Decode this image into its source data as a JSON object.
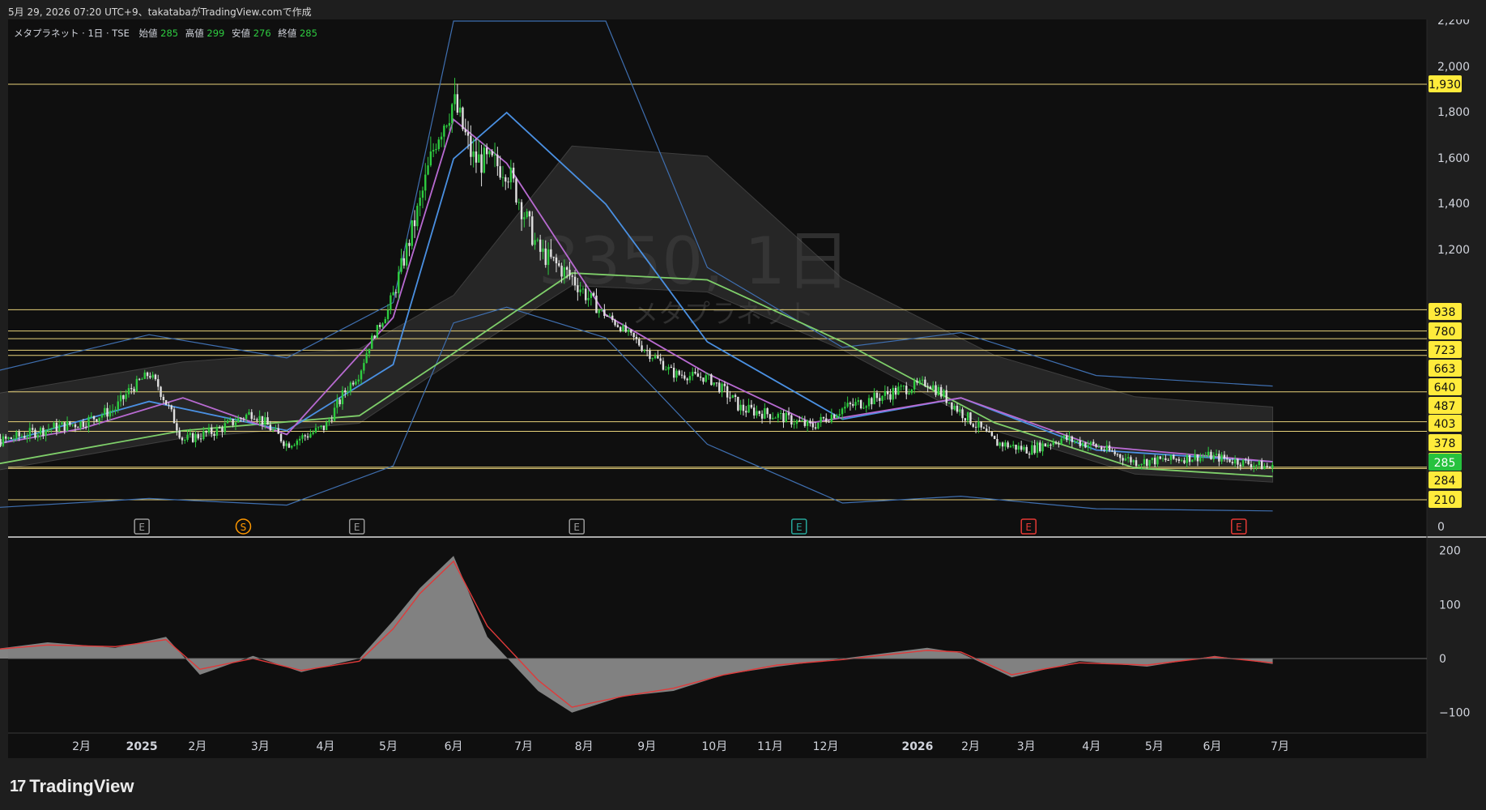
{
  "header": {
    "created_line": "5月 29, 2026 07:20 UTC+9、takatabaがTradingView.comで作成"
  },
  "legend": {
    "symbol_desc": "メタプラネット · 1日 · TSE",
    "open_label": "始値",
    "open_value": "285",
    "high_label": "高値",
    "high_value": "299",
    "low_label": "安値",
    "low_value": "276",
    "close_label": "終値",
    "close_value": "285"
  },
  "watermark": {
    "main": "3350, 1日",
    "sub": "メタプラネット"
  },
  "brand": {
    "logo": "17",
    "name": "TradingView"
  },
  "colors": {
    "background": "#0f0f0f",
    "up_candle": "#2ecc40",
    "down_candle": "#e0e0e0",
    "level_line": "#e8d27a",
    "level_badge": "#ffeb3b",
    "last_price_badge": "#26c23e",
    "ma_short": "#b86ad1",
    "ma_mid": "#4a90e2",
    "ma_long": "#7fcf6a",
    "bollinger": "#3f6fb0",
    "ichimoku_cloud": "#3a3a3a",
    "osc_signal": "#e03a3a",
    "osc_fill": "#8e8e8e"
  },
  "chart_data": [
    {
      "type": "line",
      "title": "メタプラネット · 1日 · TSE",
      "y_axis": {
        "ticks": [
          0,
          1200,
          1400,
          1600,
          1800,
          2000,
          2200
        ],
        "tick_labels": [
          "0",
          "1,200",
          "1,400",
          "1,600",
          "1,800",
          "2,000",
          "2,200"
        ],
        "scale": "custom-compressed"
      },
      "x_axis": {
        "tick_labels": [
          "2月",
          "2025",
          "2月",
          "3月",
          "4月",
          "5月",
          "6月",
          "7月",
          "8月",
          "9月",
          "10月",
          "11月",
          "12月",
          "2026",
          "2月",
          "3月",
          "4月",
          "5月",
          "6月",
          "7月"
        ]
      },
      "horizontal_levels": [
        1930,
        938,
        780,
        723,
        663,
        640,
        487,
        403,
        378,
        287,
        284,
        210
      ],
      "last_price": 285,
      "series": [
        {
          "kind": "close",
          "x": [
            "2024-12-02",
            "2024-12-16",
            "2025-01-06",
            "2025-01-20",
            "2025-02-03",
            "2025-02-17",
            "2025-03-03",
            "2025-03-17",
            "2025-04-01",
            "2025-04-15",
            "2025-05-01",
            "2025-05-15",
            "2025-05-29",
            "2025-06-09",
            "2025-06-16",
            "2025-06-23",
            "2025-07-01",
            "2025-07-15",
            "2025-07-28",
            "2025-08-11",
            "2025-08-25",
            "2025-09-08",
            "2025-09-22",
            "2025-10-06",
            "2025-10-20",
            "2025-11-04",
            "2025-11-18",
            "2025-12-01",
            "2025-12-15",
            "2026-01-05",
            "2026-01-19",
            "2026-02-02",
            "2026-02-16",
            "2026-03-02",
            "2026-03-16",
            "2026-04-01",
            "2026-04-15",
            "2026-05-01",
            "2026-05-15",
            "2026-05-28"
          ],
          "values": [
            310,
            350,
            385,
            400,
            440,
            560,
            355,
            380,
            430,
            345,
            390,
            560,
            1000,
            1400,
            1700,
            1850,
            1600,
            1560,
            1200,
            1080,
            900,
            690,
            560,
            540,
            440,
            420,
            390,
            440,
            470,
            520,
            430,
            350,
            330,
            360,
            340,
            300,
            305,
            315,
            300,
            285
          ]
        },
        {
          "kind": "ma_short",
          "x": [
            "2024-12-02",
            "2025-01-20",
            "2025-03-03",
            "2025-04-15",
            "2025-05-29",
            "2025-06-23",
            "2025-07-15",
            "2025-08-25",
            "2025-10-06",
            "2025-11-18",
            "2026-01-19",
            "2026-03-16",
            "2026-05-28"
          ],
          "values": [
            330,
            385,
            470,
            370,
            880,
            1770,
            1580,
            900,
            560,
            400,
            470,
            340,
            300
          ]
        },
        {
          "kind": "ma_mid",
          "x": [
            "2024-12-02",
            "2025-02-17",
            "2025-04-15",
            "2025-05-29",
            "2025-06-23",
            "2025-07-15",
            "2025-08-25",
            "2025-10-06",
            "2025-12-01",
            "2026-01-19",
            "2026-03-16",
            "2026-05-28"
          ],
          "values": [
            320,
            460,
            380,
            600,
            1600,
            1800,
            1400,
            700,
            410,
            470,
            330,
            300
          ]
        },
        {
          "kind": "ma_long",
          "x": [
            "2024-12-02",
            "2025-03-03",
            "2025-05-15",
            "2025-06-23",
            "2025-08-11",
            "2025-10-06",
            "2025-12-01",
            "2026-02-02",
            "2026-04-01",
            "2026-05-28"
          ],
          "values": [
            280,
            380,
            420,
            650,
            1100,
            1070,
            700,
            400,
            285,
            265
          ]
        }
      ]
    },
    {
      "type": "area",
      "title": "oscillator",
      "y_axis": {
        "ticks": [
          -100,
          0,
          100,
          200
        ],
        "tick_labels": [
          "−100",
          "0",
          "100",
          "200"
        ]
      },
      "series": [
        {
          "kind": "histogram_area",
          "x": [
            "2024-12-02",
            "2025-01-06",
            "2025-02-03",
            "2025-02-24",
            "2025-03-10",
            "2025-04-01",
            "2025-04-21",
            "2025-05-15",
            "2025-05-29",
            "2025-06-09",
            "2025-06-23",
            "2025-07-07",
            "2025-07-28",
            "2025-08-11",
            "2025-09-01",
            "2025-09-22",
            "2025-10-13",
            "2025-11-04",
            "2025-12-01",
            "2026-01-05",
            "2026-01-19",
            "2026-02-09",
            "2026-03-09",
            "2026-04-06",
            "2026-05-04",
            "2026-05-28"
          ],
          "values": [
            10,
            30,
            20,
            40,
            -30,
            5,
            -25,
            0,
            70,
            130,
            190,
            40,
            -60,
            -100,
            -70,
            -60,
            -30,
            -15,
            0,
            20,
            10,
            -35,
            -5,
            -15,
            5,
            -10
          ]
        },
        {
          "kind": "signal",
          "x": [
            "2024-12-02",
            "2025-01-06",
            "2025-02-03",
            "2025-02-24",
            "2025-03-10",
            "2025-04-01",
            "2025-04-21",
            "2025-05-15",
            "2025-05-29",
            "2025-06-09",
            "2025-06-23",
            "2025-07-07",
            "2025-07-28",
            "2025-08-11",
            "2025-09-01",
            "2025-09-22",
            "2025-10-13",
            "2025-11-04",
            "2025-12-01",
            "2026-01-05",
            "2026-01-19",
            "2026-02-09",
            "2026-03-09",
            "2026-04-06",
            "2026-05-04",
            "2026-05-28"
          ],
          "values": [
            12,
            25,
            22,
            35,
            -20,
            0,
            -22,
            -5,
            55,
            120,
            180,
            60,
            -40,
            -90,
            -70,
            -55,
            -30,
            -12,
            -2,
            15,
            12,
            -30,
            -8,
            -12,
            3,
            -8
          ]
        }
      ]
    }
  ],
  "event_markers": [
    {
      "label": "E",
      "date": "2025-02-14",
      "kind": "earnings",
      "color": "#9a9a9a"
    },
    {
      "label": "S",
      "date": "2025-03-28",
      "kind": "split",
      "color": "#ff9800"
    },
    {
      "label": "E",
      "date": "2025-05-14",
      "kind": "earnings",
      "color": "#9a9a9a"
    },
    {
      "label": "E",
      "date": "2025-08-13",
      "kind": "earnings",
      "color": "#9a9a9a"
    },
    {
      "label": "E",
      "date": "2025-11-13",
      "kind": "earnings",
      "color": "#26a69a"
    },
    {
      "label": "E",
      "date": "2026-02-16",
      "kind": "earnings",
      "color": "#e53935"
    },
    {
      "label": "E",
      "date": "2026-05-14",
      "kind": "earnings",
      "color": "#e53935"
    }
  ]
}
